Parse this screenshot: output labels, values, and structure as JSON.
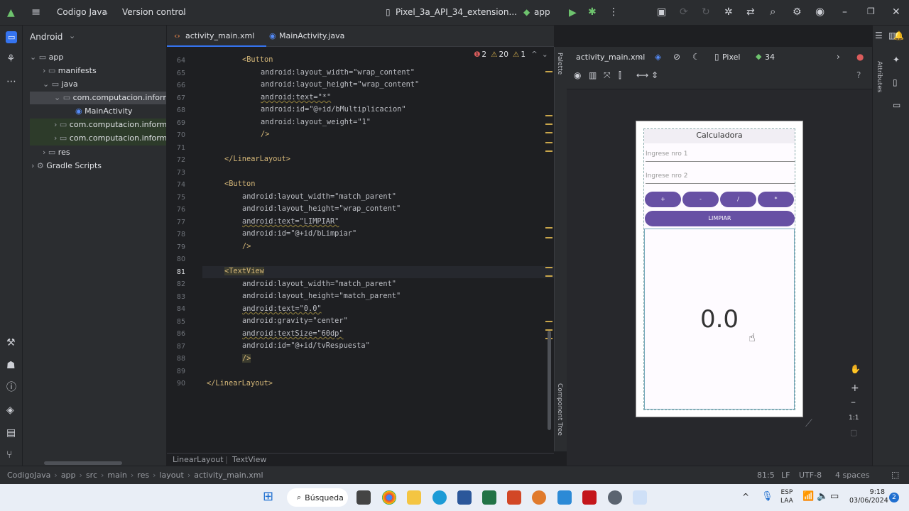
{
  "titlebar": {
    "project": "Codigo Java",
    "vcs": "Version control",
    "device": "Pixel_3a_API_34_extension...",
    "run_config": "app"
  },
  "project_panel": {
    "selector": "Android",
    "tree": [
      {
        "label": "app",
        "level": 0
      },
      {
        "label": "manifests",
        "level": 1
      },
      {
        "label": "java",
        "level": 1
      },
      {
        "label": "com.computacion.informa",
        "level": 2
      },
      {
        "label": "MainActivity",
        "level": 3
      },
      {
        "label": "com.computacion.informa",
        "level": 2
      },
      {
        "label": "com.computacion.informa",
        "level": 2
      },
      {
        "label": "res",
        "level": 1
      },
      {
        "label": "Gradle Scripts",
        "level": 0
      }
    ]
  },
  "editor": {
    "tabs": [
      {
        "label": "activity_main.xml"
      },
      {
        "label": "MainActivity.java"
      }
    ],
    "inspections": {
      "errors": "2",
      "warnings": "20",
      "weak": "1"
    },
    "line_numbers": [
      "64",
      "65",
      "66",
      "67",
      "68",
      "69",
      "70",
      "71",
      "72",
      "73",
      "74",
      "75",
      "76",
      "77",
      "78",
      "79",
      "80",
      "81",
      "82",
      "83",
      "84",
      "85",
      "86",
      "87",
      "88",
      "89",
      "90"
    ],
    "breadcrumb": [
      "LinearLayout",
      "TextView"
    ]
  },
  "code": {
    "l63": "<Button",
    "l64": "android:layout_width=\"wrap_content\"",
    "l65": "android:layout_height=\"wrap_content\"",
    "l66": "android:text=\"*\"",
    "l67": "android:id=\"@+id/bMultiplicacion\"",
    "l68": "android:layout_weight=\"1\"",
    "l69": "/>",
    "l71": "</LinearLayout>",
    "l73": "<Button",
    "l74": "android:layout_width=\"match_parent\"",
    "l75": "android:layout_height=\"wrap_content\"",
    "l76": "android:text=\"LIMPIAR\"",
    "l77": "android:id=\"@+id/bLimpiar\"",
    "l78": "/>",
    "l80": "<TextView",
    "l81": "android:layout_width=\"match_parent\"",
    "l82": "android:layout_height=\"match_parent\"",
    "l83": "android:text=\"0.0\"",
    "l84": "android:gravity=\"center\"",
    "l85": "android:textSize=\"60dp\"",
    "l86": "android:id=\"@+id/tvRespuesta\"",
    "l87": "/>",
    "l89": "</LinearLayout>"
  },
  "design": {
    "file": "activity_main.xml",
    "device": "Pixel",
    "api": "34",
    "side_palette": "Palette",
    "side_tree": "Component Tree",
    "side_attrs": "Attributes",
    "zoom_label": "1:1"
  },
  "preview": {
    "title": "Calculadora",
    "hint1": "Ingrese nro 1",
    "hint2": "Ingrese nro 2",
    "buttons": [
      "+",
      "-",
      "/",
      "*"
    ],
    "clear": "LIMPIAR",
    "result": "0.0"
  },
  "statusbar": {
    "path": [
      "CodigoJava",
      "app",
      "src",
      "main",
      "res",
      "layout",
      "activity_main.xml"
    ],
    "position": "81:5",
    "line_sep": "LF",
    "encoding": "UTF-8",
    "indent": "4 spaces"
  },
  "taskbar": {
    "search": "Búsqueda",
    "lang1": "ESP",
    "lang2": "LAA",
    "time": "9:18",
    "date": "03/06/2024",
    "badge": "2"
  }
}
